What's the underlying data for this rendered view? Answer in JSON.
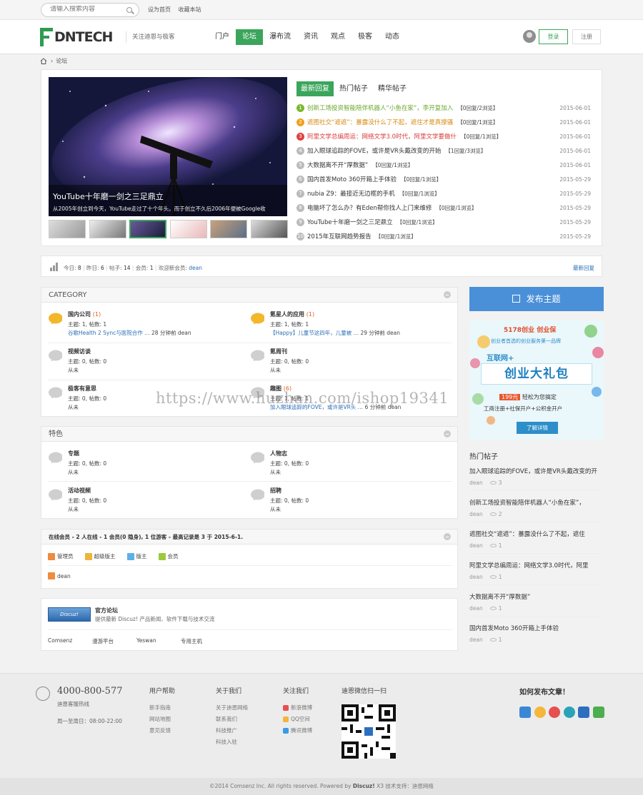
{
  "topbar": {
    "search_placeholder": "请输入搜索内容",
    "links": [
      "设为首页",
      "收藏本站"
    ]
  },
  "header": {
    "logo_text": "DNTECH",
    "slogan": "关注迪恩与极客",
    "nav": [
      "门户",
      "论坛",
      "瀑布流",
      "资讯",
      "观点",
      "极客",
      "动态"
    ],
    "nav_active": 1,
    "login": "登录",
    "register": "注册"
  },
  "breadcrumb": {
    "current": "论坛"
  },
  "slider": {
    "title": "YouTube十年磨一剑之三足鼎立",
    "subtitle": "从2005年创立到今天，YouTube走过了十个年头。而于创立不久后2006年便被Google收"
  },
  "hot_tabs": [
    "最新回复",
    "热门帖子",
    "精华帖子"
  ],
  "latest_posts": [
    {
      "n": "1",
      "title": "创新工场投资智能陪伴机器人“小鱼在家”，李开复加入",
      "info": "【0回复/2浏览】",
      "date": "2015-06-01",
      "color": "#7cb82f"
    },
    {
      "n": "2",
      "title": "遮图社交“遮遮”：暴露没什么了不起，遮住才是真撩骚",
      "info": "【0回复/1浏览】",
      "date": "2015-06-01",
      "color": "#f0a020"
    },
    {
      "n": "3",
      "title": "阿里文学总编周运：网络文学3.0时代，阿里文学要做什",
      "info": "【0回复/1浏览】",
      "date": "2015-06-01",
      "color": "#e04040"
    },
    {
      "n": "4",
      "title": "加入眼球追踪的FOVE，或许是VR头戴改变的开始",
      "info": "【1回复/3浏览】",
      "date": "2015-06-01",
      "color": "#bbb"
    },
    {
      "n": "5",
      "title": "大数据离不开“厚数据”",
      "info": "【0回复/1浏览】",
      "date": "2015-06-01",
      "color": "#bbb"
    },
    {
      "n": "6",
      "title": "国内首发Moto 360开箱上手体验",
      "info": "【0回复/1浏览】",
      "date": "2015-05-29",
      "color": "#bbb"
    },
    {
      "n": "7",
      "title": "nubia Z9：最接近无边框的手机",
      "info": "【0回复/1浏览】",
      "date": "2015-05-29",
      "color": "#bbb"
    },
    {
      "n": "8",
      "title": "电脑坏了怎么办？有Eden帮你找人上门来维修",
      "info": "【0回复/1浏览】",
      "date": "2015-05-29",
      "color": "#bbb"
    },
    {
      "n": "9",
      "title": "YouTube十年磨一剑之三足鼎立",
      "info": "【0回复/1浏览】",
      "date": "2015-05-29",
      "color": "#bbb"
    },
    {
      "n": "10",
      "title": "2015年互联网趋势报告",
      "info": "【0回复/1浏览】",
      "date": "2015-05-29",
      "color": "#bbb"
    }
  ],
  "stats": {
    "today_label": "今日:",
    "today": "8",
    "yesterday_label": "昨日:",
    "yesterday": "6",
    "posts_label": "帖子:",
    "posts": "14",
    "members_label": "会员:",
    "members": "1",
    "welcome": "欢迎新会员:",
    "newest": "dean",
    "new_reply": "最新回复"
  },
  "category": {
    "title": "CATEGORY",
    "forums": [
      {
        "name": "国内公司",
        "count": "(1)",
        "stats": "主题: 1, 帖数: 1",
        "last": "谷歌Health 2 Sync与医院合作 …",
        "time": "28 分钟前 dean",
        "active": true
      },
      {
        "name": "氪星人的应用",
        "count": "(1)",
        "stats": "主题: 1, 帖数: 1",
        "last": "【Happy】儿童节这四年，儿童被 …",
        "time": "29 分钟前 dean",
        "active": true
      },
      {
        "name": "视频访谈",
        "count": "",
        "stats": "主题: 0, 帖数: 0",
        "last": "",
        "time": "从未",
        "active": false
      },
      {
        "name": "氪周刊",
        "count": "",
        "stats": "主题: 0, 帖数: 0",
        "last": "",
        "time": "从未",
        "active": false
      },
      {
        "name": "极客有意思",
        "count": "",
        "stats": "主题: 0, 帖数: 0",
        "last": "",
        "time": "从未",
        "active": false
      },
      {
        "name": "趣图",
        "count": "(6)",
        "stats": "主题: 1, 帖数: 1",
        "last": "加入眼球追踪的FOVE，或许是VR头 …",
        "time": "6 分钟前 dean",
        "active": false
      }
    ]
  },
  "features": {
    "title": "特色",
    "forums": [
      {
        "name": "专题",
        "stats": "主题: 0, 帖数: 0",
        "time": "从未"
      },
      {
        "name": "人物志",
        "stats": "主题: 0, 帖数: 0",
        "time": "从未"
      },
      {
        "name": "活动视频",
        "stats": "主题: 0, 帖数: 0",
        "time": "从未"
      },
      {
        "name": "招聘",
        "stats": "主题: 0, 帖数: 0",
        "time": "从未"
      }
    ]
  },
  "online": {
    "title": "在线会员 - 2 人在线 - 1 会员(0 隐身), 1 位游客 - 最高记录是 3 于 2015-6-1.",
    "roles": [
      "管理员",
      "超级版主",
      "版主",
      "会员"
    ],
    "user": "dean"
  },
  "links": {
    "title": "官方论坛",
    "desc": "提供最新 Discuz! 产品新闻、软件下载与技术交流",
    "badge": "Discuz!",
    "items": [
      "Comsenz",
      "漫游平台",
      "Yeswan",
      "专用主机"
    ]
  },
  "sidebar": {
    "post_button": "发布主题",
    "ad": {
      "top": "5178创业",
      "brand": "创业保",
      "tag": "创业者首选的创业服务第一品牌",
      "l1": "互联网+",
      "l2": "创业大礼包",
      "price": "199元",
      "l3": "轻松为您搞定",
      "l4": "工商注册+社保开户+公积金开户",
      "cta": "了解详情"
    },
    "hot_title": "热门帖子",
    "hot": [
      {
        "title": "加入眼球追踪的FOVE，或许是VR头戴改变的开",
        "author": "dean",
        "views": "3"
      },
      {
        "title": "创新工场投资智能陪伴机器人“小鱼在家”，",
        "author": "dean",
        "views": "2"
      },
      {
        "title": "遮图社交“遮遮”：暴露没什么了不起，遮住",
        "author": "dean",
        "views": "1"
      },
      {
        "title": "阿里文学总编周运：网络文学3.0时代，阿里",
        "author": "dean",
        "views": "1"
      },
      {
        "title": "大数据离不开“厚数据”",
        "author": "dean",
        "views": "1"
      },
      {
        "title": "国内首发Moto 360开箱上手体验",
        "author": "dean",
        "views": "1"
      }
    ]
  },
  "footer": {
    "phone": "4000-800-577",
    "phone_label": "迪恩客服热线",
    "hours": "周一至周日：08:00-22:00",
    "help": {
      "title": "用户帮助",
      "items": [
        "新手指南",
        "网站地图",
        "意见反馈"
      ]
    },
    "about": {
      "title": "关于我们",
      "items": [
        "关于迪恩网络",
        "联系我们",
        "科技推广",
        "科技入驻"
      ]
    },
    "follow": {
      "title": "关注我们",
      "items": [
        "新浪微博",
        "QQ空间",
        "腾讯微博"
      ]
    },
    "wechat": "迪恩微信扫一扫",
    "howto": "如何发布文章！"
  },
  "copyright": {
    "pre": "©2014  Comsenz Inc.  All rights reserved.   Powered by ",
    "brand": "Discuz!",
    "post": " X3  技术支持：迪恩网络"
  },
  "watermark": "https://www.huzhan.com/ishop19341",
  "colors": {
    "accent": "#3aa55b",
    "blue": "#4a90d9"
  }
}
